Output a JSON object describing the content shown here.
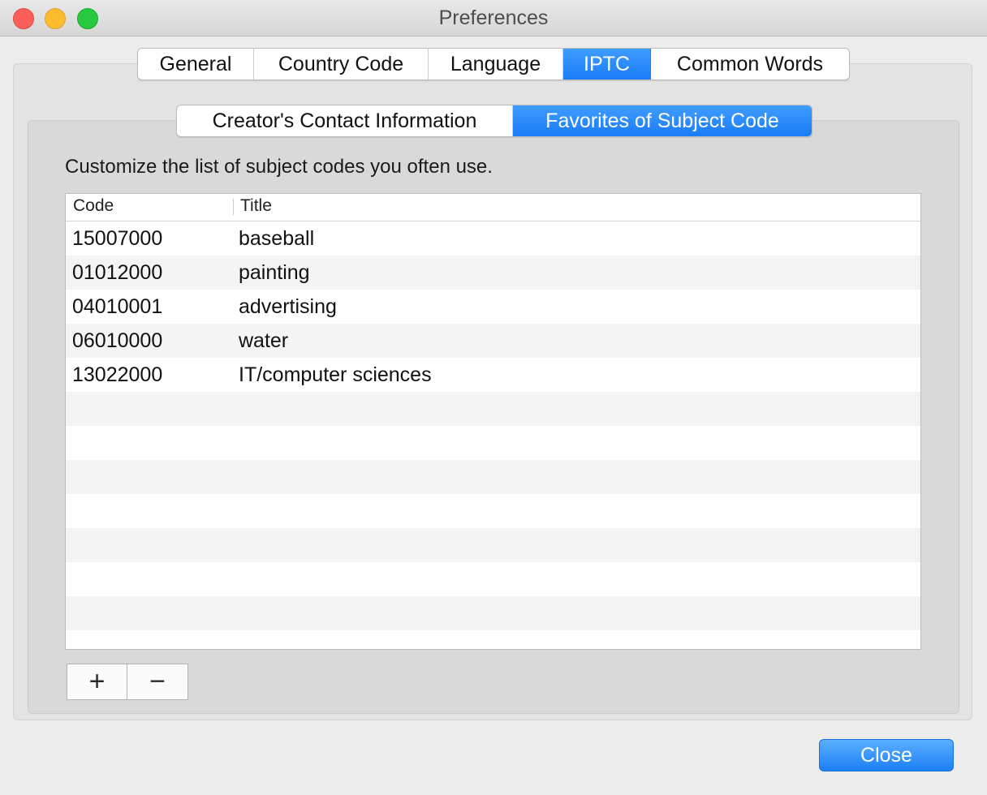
{
  "window": {
    "title": "Preferences"
  },
  "top_tabs": [
    {
      "label": "General",
      "active": false
    },
    {
      "label": "Country Code",
      "active": false
    },
    {
      "label": "Language",
      "active": false
    },
    {
      "label": "IPTC",
      "active": true
    },
    {
      "label": "Common Words",
      "active": false
    }
  ],
  "sub_tabs": [
    {
      "label": "Creator's Contact Information",
      "active": false
    },
    {
      "label": "Favorites of Subject Code",
      "active": true
    }
  ],
  "instruction": "Customize the list of subject codes you often use.",
  "table": {
    "columns": {
      "code": "Code",
      "title": "Title"
    },
    "rows": [
      {
        "code": "15007000",
        "title": "baseball"
      },
      {
        "code": "01012000",
        "title": "painting"
      },
      {
        "code": "04010001",
        "title": "advertising"
      },
      {
        "code": "06010000",
        "title": "water"
      },
      {
        "code": "13022000",
        "title": "IT/computer sciences"
      }
    ]
  },
  "buttons": {
    "add": "+",
    "remove": "−",
    "close": "Close"
  },
  "colors": {
    "accent": "#1a7cf7",
    "window_bg": "#ececec"
  }
}
